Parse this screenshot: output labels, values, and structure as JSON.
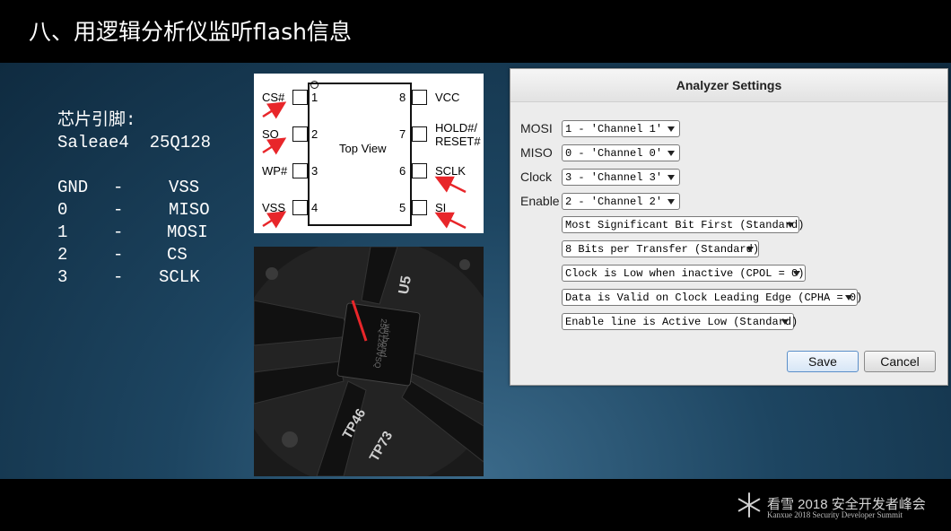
{
  "slide_title": "八、用逻辑分析仪监听flash信息",
  "pin_notes": {
    "heading": "芯片引脚:",
    "subheading": "Saleae4  25Q128",
    "rows": [
      {
        "left": "GND",
        "dash": "-",
        "right": "VSS"
      },
      {
        "left": "0",
        "dash": "-",
        "right": "MISO"
      },
      {
        "left": "1",
        "dash": "-",
        "right": "MOSI"
      },
      {
        "left": "2",
        "dash": "-",
        "right": "CS"
      },
      {
        "left": "3",
        "dash": "-",
        "right": "SCLK"
      }
    ]
  },
  "chip_diagram": {
    "center_label": "Top View",
    "left_pins": [
      {
        "num": "1",
        "label": "CS#"
      },
      {
        "num": "2",
        "label": "SO"
      },
      {
        "num": "3",
        "label": "WP#"
      },
      {
        "num": "4",
        "label": "VSS"
      }
    ],
    "right_pins": [
      {
        "num": "8",
        "label": "VCC"
      },
      {
        "num": "7",
        "label": "HOLD#/ RESET#"
      },
      {
        "num": "6",
        "label": "SCLK"
      },
      {
        "num": "5",
        "label": "SI"
      }
    ],
    "arrow_color": "#e8262a"
  },
  "board_photo": {
    "silkscreen": [
      "U5",
      "TP46",
      "TP73",
      "winbond",
      "25Q128JVSQ"
    ]
  },
  "dialog": {
    "title": "Analyzer Settings",
    "fields": [
      {
        "label": "MOSI",
        "value": "1 - 'Channel 1'"
      },
      {
        "label": "MISO",
        "value": "0 - 'Channel 0'"
      },
      {
        "label": "Clock",
        "value": "3 - 'Channel 3'"
      },
      {
        "label": "Enable",
        "value": "2 - 'Channel 2'"
      }
    ],
    "options": [
      "Most Significant Bit First (Standard)",
      "8 Bits per Transfer (Standard)",
      "Clock is Low when inactive (CPOL = 0)",
      "Data is Valid on Clock Leading Edge (CPHA = 0)",
      "Enable line is Active Low (Standard)"
    ],
    "save_label": "Save",
    "cancel_label": "Cancel"
  },
  "footer": {
    "zh": "看雪 2018 安全开发者峰会",
    "en": "Kanxue 2018 Security Developer Summit"
  }
}
